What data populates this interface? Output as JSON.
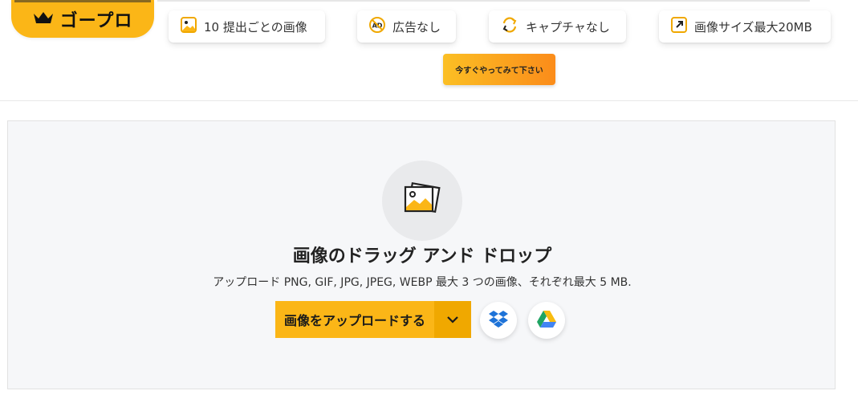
{
  "brand": {
    "pro_label": "ゴープロ",
    "icon": "crown-icon",
    "accent": "#fbb617"
  },
  "features": [
    {
      "icon": "images-icon",
      "label": "10 提出ごとの画像"
    },
    {
      "icon": "no-ads-icon",
      "label": "広告なし"
    },
    {
      "icon": "no-captcha-icon",
      "label": "キャプチャなし"
    },
    {
      "icon": "expand-size-icon",
      "label": "画像サイズ最大20MB"
    }
  ],
  "cta": {
    "try_now": "今すぐやってみて下さい"
  },
  "upload": {
    "icon": "image-stack-icon",
    "title": "画像のドラッグ アンド ドロップ",
    "subtitle": "アップロード PNG, GIF, JPG, JPEG, WEBP 最大 3 つの画像、それぞれ最大 5 MB.",
    "button_label": "画像をアップロードする",
    "dropdown_icon": "chevron-down-icon",
    "sources": [
      "dropbox-icon",
      "google-drive-icon"
    ]
  }
}
